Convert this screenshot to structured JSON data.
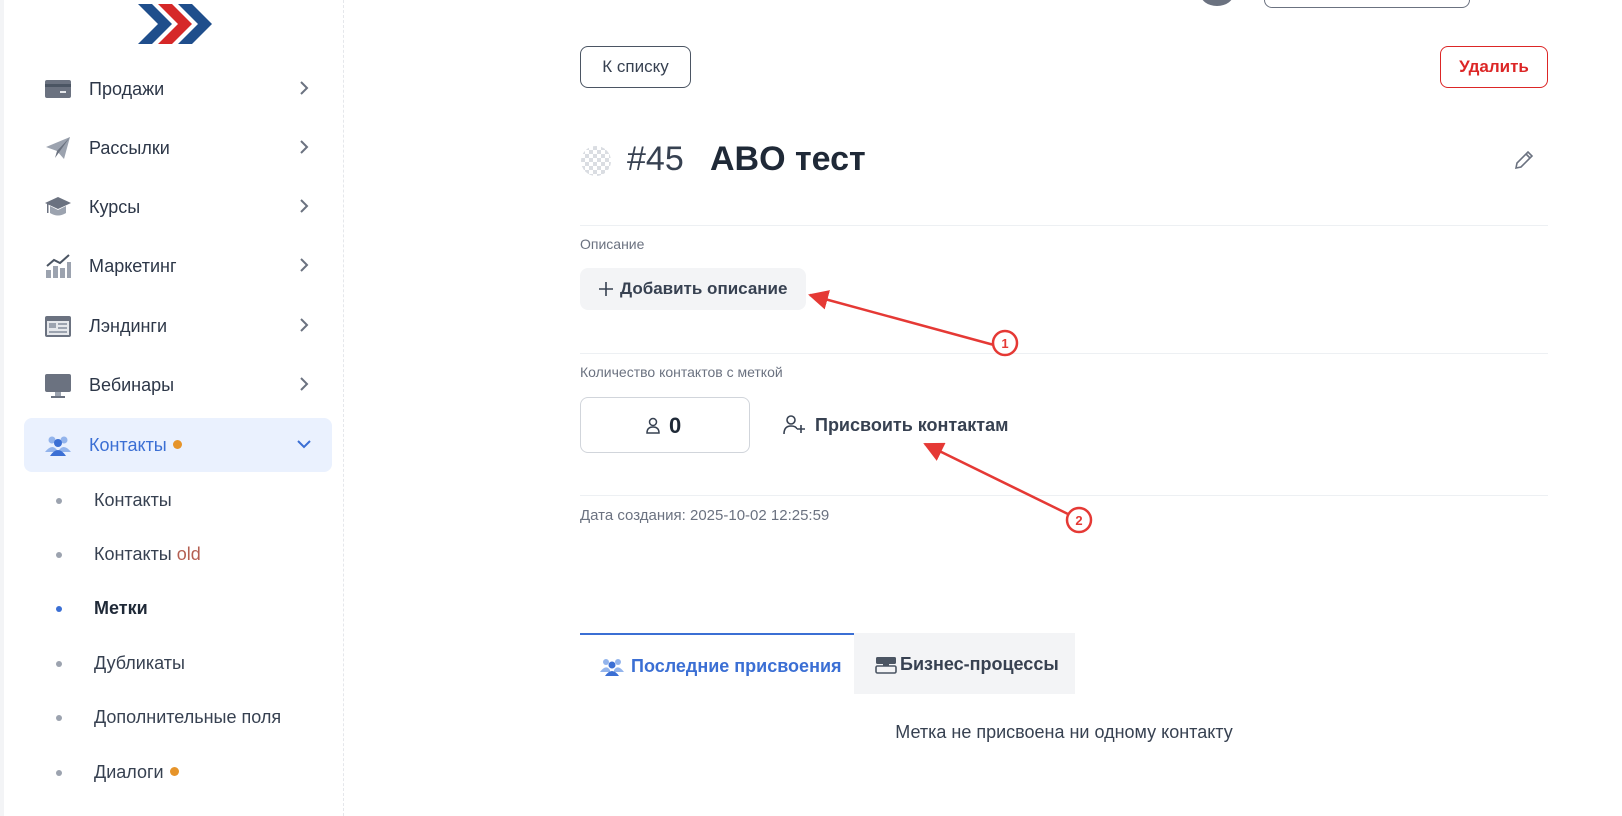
{
  "sidebar": {
    "items": [
      {
        "label": "Продажи",
        "icon": "card-icon"
      },
      {
        "label": "Рассылки",
        "icon": "paper-plane-icon"
      },
      {
        "label": "Курсы",
        "icon": "graduation-cap-icon"
      },
      {
        "label": "Маркетинг",
        "icon": "growth-chart-icon"
      },
      {
        "label": "Лэндинги",
        "icon": "landing-page-icon"
      },
      {
        "label": "Вебинары",
        "icon": "monitor-icon"
      },
      {
        "label": "Контакты",
        "icon": "users-icon",
        "active": true
      }
    ],
    "subitems": [
      {
        "label": "Контакты"
      },
      {
        "label": "Контакты",
        "tag": "old"
      },
      {
        "label": "Метки",
        "active": true
      },
      {
        "label": "Дубликаты"
      },
      {
        "label": "Дополнительные поля"
      },
      {
        "label": "Диалоги"
      }
    ]
  },
  "toolbar": {
    "back_label": "К списку",
    "delete_label": "Удалить"
  },
  "tag": {
    "number": "#45",
    "name": "ABO тест"
  },
  "description": {
    "label": "Описание",
    "add_label": "Добавить описание"
  },
  "contacts": {
    "label": "Количество контактов с меткой",
    "count": "0",
    "assign_label": "Присвоить контактам"
  },
  "created": "Дата создания: 2025-10-02 12:25:59",
  "tabs": [
    {
      "label": "Последние присвоения",
      "active": true
    },
    {
      "label": "Бизнес-процессы"
    }
  ],
  "empty_message": "Метка не присвоена ни одному контакту",
  "annotations": [
    {
      "label": "1"
    },
    {
      "label": "2"
    }
  ],
  "colors": {
    "accent": "#3b6fd4",
    "danger": "#dc2626",
    "badge": "#e6942a",
    "annotation": "#e53935"
  }
}
